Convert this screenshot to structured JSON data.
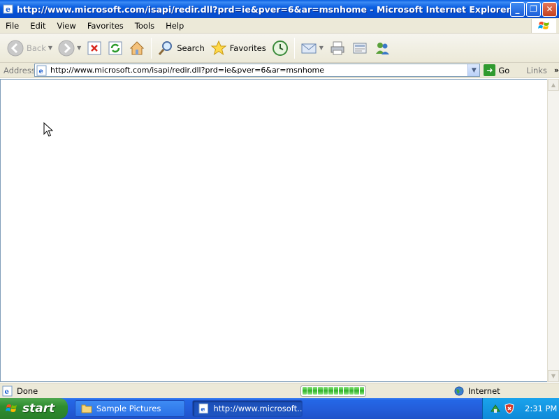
{
  "window": {
    "title": "http://www.microsoft.com/isapi/redir.dll?prd=ie&pver=6&ar=msnhome - Microsoft Internet Explorer",
    "minimize_label": "_",
    "maximize_label": "❐",
    "close_label": "✕"
  },
  "menu": {
    "file": "File",
    "edit": "Edit",
    "view": "View",
    "favorites": "Favorites",
    "tools": "Tools",
    "help": "Help"
  },
  "toolbar": {
    "back": "Back",
    "search": "Search",
    "favorites": "Favorites"
  },
  "address": {
    "label": "Address",
    "url": "http://www.microsoft.com/isapi/redir.dll?prd=ie&pver=6&ar=msnhome",
    "go": "Go",
    "links": "Links"
  },
  "status": {
    "text": "Done",
    "progress_segments": 12,
    "zone": "Internet"
  },
  "taskbar": {
    "start": "start",
    "tasks": [
      {
        "label": "Sample Pictures"
      },
      {
        "label": "http://www.microsoft..."
      }
    ],
    "clock": "2:31 PM"
  },
  "colors": {
    "titlebar": "#0a5fe0",
    "chrome": "#ece9d8",
    "taskbar": "#245edb",
    "start": "#2f8d2f",
    "tray": "#0f8ad9"
  }
}
